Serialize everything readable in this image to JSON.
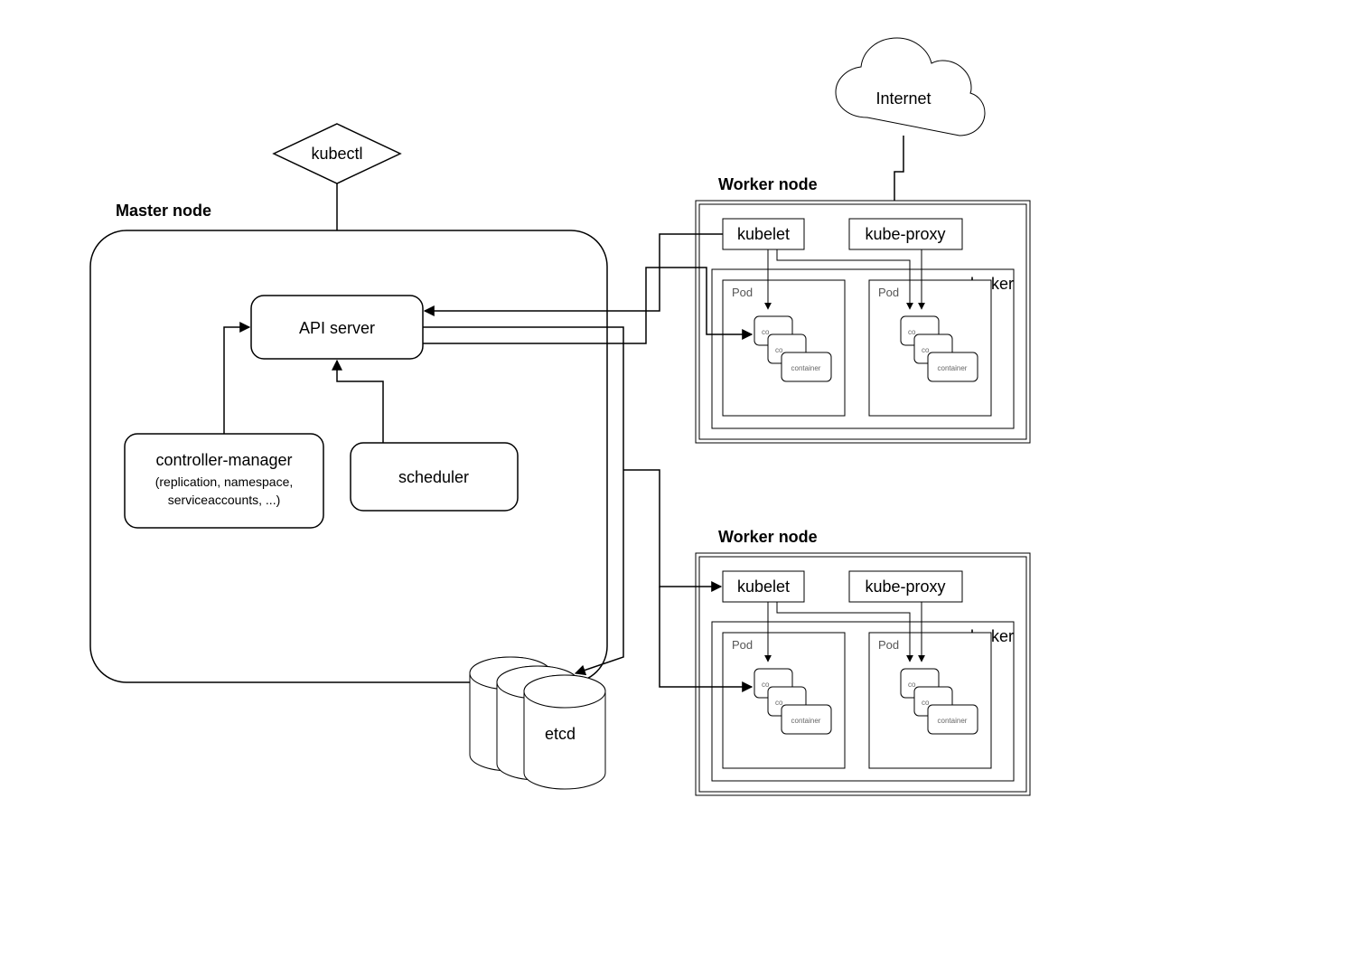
{
  "diagram": {
    "kubectl": "kubectl",
    "internet": "Internet",
    "master": {
      "title": "Master node",
      "api_server": "API server",
      "controller_manager": "controller-manager",
      "controller_manager_sub": "(replication, namespace, serviceaccounts, ...)",
      "scheduler": "scheduler",
      "etcd": "etcd"
    },
    "worker": {
      "title": "Worker node",
      "kubelet": "kubelet",
      "kube_proxy": "kube-proxy",
      "docker": "docker",
      "pod": "Pod",
      "container": "container",
      "co": "co"
    }
  }
}
